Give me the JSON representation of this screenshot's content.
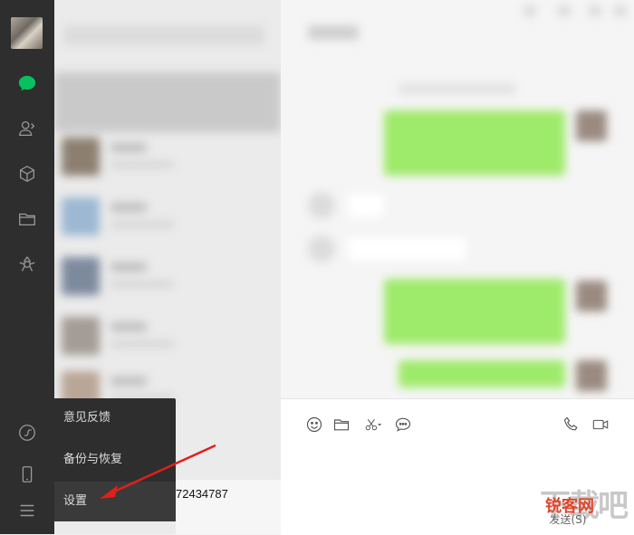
{
  "menu": {
    "items": [
      {
        "label": "意见反馈"
      },
      {
        "label": "备份与恢复"
      },
      {
        "label": "设置"
      }
    ]
  },
  "partial_text": "72434787",
  "input_area": {
    "send_label": "发送(S)"
  },
  "watermark": {
    "text": "下载吧",
    "logo_text": "锐客网"
  },
  "colors": {
    "sidebar_bg": "#2e2e2e",
    "chat_active_green": "#07c160",
    "bubble_green": "#9eea6a",
    "arrow_red": "#e0201b"
  },
  "icons": {
    "sidebar_top": [
      "chat-icon",
      "contacts-icon",
      "favorites-icon",
      "files-icon",
      "moments-icon"
    ],
    "sidebar_bottom": [
      "mini-program-icon",
      "phone-icon",
      "menu-icon"
    ],
    "toolbar": [
      "emoji-icon",
      "folder-icon",
      "scissors-icon",
      "chat-bubble-icon",
      "voice-call-icon",
      "video-call-icon"
    ]
  }
}
